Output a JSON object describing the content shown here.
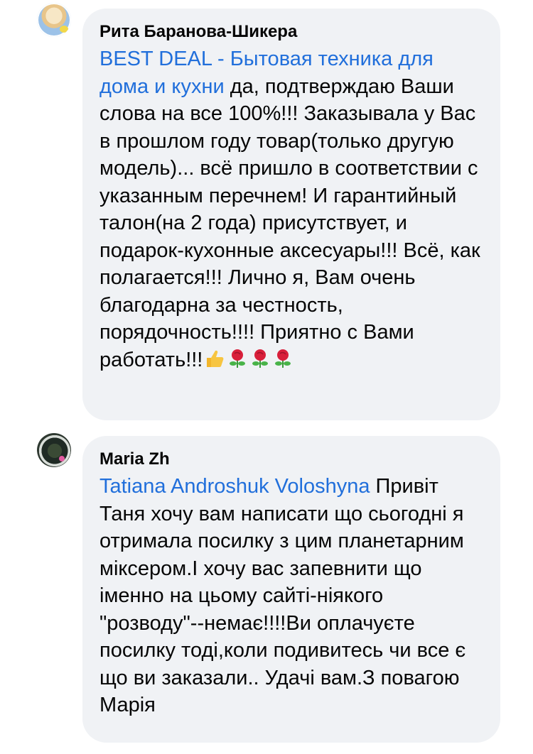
{
  "comments": [
    {
      "author": "Рита Баранова-Шикера",
      "mention": "BEST DEAL - Бытовая техника для дома и кухни",
      "text": " да, подтверждаю Ваши слова на все 100%!!! Заказывала у Вас в прошлом году товар(только другую модель)... всё пришло в соответствии с указанным перечнем! И гарантийный талон(на 2 года) присутствует, и подарок-кухонные аксесуары!!! Всё, как полагается!!! Лично я, Вам очень благодарна за честность, порядочность!!!! Приятно с Вами работать!!!",
      "emojis": [
        "thumbs-up-icon",
        "rose-icon",
        "rose-icon",
        "rose-icon"
      ]
    },
    {
      "author": "Maria Zh",
      "mention": "Tatiana Androshuk Voloshyna",
      "text": " Привіт Таня хочу вам написати що сьогодні я отримала посилку з цим планетарним міксером.І хочу вас запевнити що іменно на цьому сайті-ніякого \"розводу\"--немає!!!!Ви оплачуєте посилку тоді,коли подивитесь чи все є що ви заказали.. Удачі вам.З повагою Марія"
    }
  ],
  "colors": {
    "bubble": "#f0f2f5",
    "mention": "#216fdb",
    "text": "#050505"
  }
}
